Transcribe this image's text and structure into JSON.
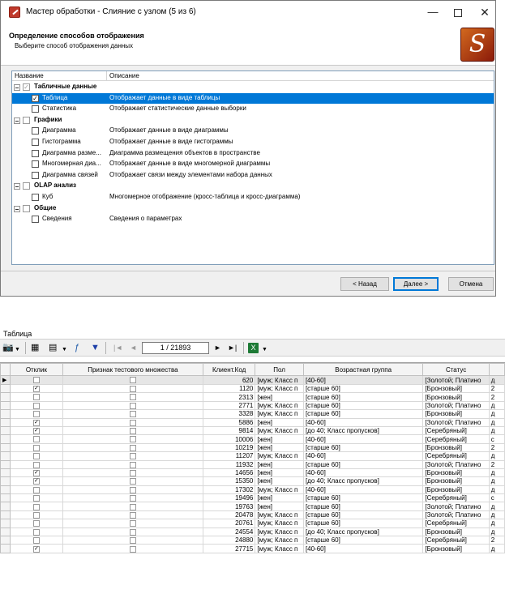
{
  "dialog": {
    "title": "Мастер обработки - Слияние с узлом (5 из 6)",
    "header_title": "Определение способов отображения",
    "header_subtitle": "Выберите способ отображения данных",
    "logo_glyph": "𝑆",
    "minimize_glyph": "—",
    "close_glyph": "✕",
    "columns": [
      "Название",
      "Описание"
    ],
    "groups": [
      {
        "name": "Табличные данные",
        "checked": true,
        "items": [
          {
            "name": "Таблица",
            "desc": "Отображает данные в виде таблицы",
            "checked": true,
            "selected": true
          },
          {
            "name": "Статистика",
            "desc": "Отображает статистические данные выборки",
            "checked": false
          }
        ]
      },
      {
        "name": "Графики",
        "checked": false,
        "items": [
          {
            "name": "Диаграмма",
            "desc": "Отображает данные в виде диаграммы",
            "checked": false
          },
          {
            "name": "Гистограмма",
            "desc": "Отображает данные в виде гистограммы",
            "checked": false
          },
          {
            "name": "Диаграмма разме...",
            "desc": "Диаграмма размещения объектов в пространстве",
            "checked": false
          },
          {
            "name": "Многомерная диа...",
            "desc": "Отображает данные в виде многомерной диаграммы",
            "checked": false
          },
          {
            "name": "Диаграмма связей",
            "desc": "Отображает связи между элементами набора данных",
            "checked": false
          }
        ]
      },
      {
        "name": "OLAP анализ",
        "checked": false,
        "items": [
          {
            "name": "Куб",
            "desc": "Многомерное отображение (кросс-таблица и кросс-диаграмма)",
            "checked": false
          }
        ]
      },
      {
        "name": "Общие",
        "checked": false,
        "items": [
          {
            "name": "Сведения",
            "desc": "Сведения о параметрах",
            "checked": false
          }
        ]
      }
    ],
    "buttons": {
      "back": "< Назад",
      "next": "Далее >",
      "cancel": "Отмена"
    }
  },
  "table_panel": {
    "title": "Таблица",
    "pager": "1 / 21893",
    "toolbar_icons": [
      "camera-icon",
      "properties-icon",
      "columns-icon",
      "formula-icon",
      "filter-icon",
      "first-page-icon",
      "prev-page-icon",
      "next-page-icon",
      "last-page-icon",
      "excel-export-icon"
    ],
    "columns": [
      "Отклик",
      "Признак тестового множества",
      "Клиент.Код",
      "Пол",
      "Возрастная группа",
      "Статус"
    ],
    "rows": [
      {
        "otklik": false,
        "test": false,
        "kod": "620",
        "pol": "[муж; Класс п",
        "vozrast": "[40-60]",
        "status": "[Золотой; Платино",
        "extra": "д"
      },
      {
        "otklik": true,
        "test": false,
        "kod": "1120",
        "pol": "[муж; Класс п",
        "vozrast": "[старше 60]",
        "status": "[Бронзовый]",
        "extra": "2"
      },
      {
        "otklik": false,
        "test": false,
        "kod": "2313",
        "pol": "[жен]",
        "vozrast": "[старше 60]",
        "status": "[Бронзовый]",
        "extra": "2"
      },
      {
        "otklik": false,
        "test": false,
        "kod": "2771",
        "pol": "[муж; Класс п",
        "vozrast": "[старше 60]",
        "status": "[Золотой; Платино",
        "extra": "д"
      },
      {
        "otklik": false,
        "test": false,
        "kod": "3328",
        "pol": "[муж; Класс п",
        "vozrast": "[старше 60]",
        "status": "[Бронзовый]",
        "extra": "д"
      },
      {
        "otklik": true,
        "test": false,
        "kod": "5886",
        "pol": "[жен]",
        "vozrast": "[40-60]",
        "status": "[Золотой; Платино",
        "extra": "д"
      },
      {
        "otklik": true,
        "test": false,
        "kod": "9814",
        "pol": "[муж; Класс п",
        "vozrast": "[до 40; Класс пропусков]",
        "status": "[Серебряный]",
        "extra": "д"
      },
      {
        "otklik": false,
        "test": false,
        "kod": "10006",
        "pol": "[жен]",
        "vozrast": "[40-60]",
        "status": "[Серебряный]",
        "extra": "с"
      },
      {
        "otklik": false,
        "test": false,
        "kod": "10219",
        "pol": "[жен]",
        "vozrast": "[старше 60]",
        "status": "[Бронзовый]",
        "extra": "2"
      },
      {
        "otklik": false,
        "test": false,
        "kod": "11207",
        "pol": "[муж; Класс п",
        "vozrast": "[40-60]",
        "status": "[Серебряный]",
        "extra": "д"
      },
      {
        "otklik": false,
        "test": false,
        "kod": "11932",
        "pol": "[жен]",
        "vozrast": "[старше 60]",
        "status": "[Золотой; Платино",
        "extra": "2"
      },
      {
        "otklik": true,
        "test": false,
        "kod": "14656",
        "pol": "[жен]",
        "vozrast": "[40-60]",
        "status": "[Бронзовый]",
        "extra": "д"
      },
      {
        "otklik": true,
        "test": false,
        "kod": "15350",
        "pol": "[жен]",
        "vozrast": "[до 40; Класс пропусков]",
        "status": "[Бронзовый]",
        "extra": "д"
      },
      {
        "otklik": false,
        "test": false,
        "kod": "17302",
        "pol": "[муж; Класс п",
        "vozrast": "[40-60]",
        "status": "[Бронзовый]",
        "extra": "д"
      },
      {
        "otklik": false,
        "test": false,
        "kod": "19496",
        "pol": "[жен]",
        "vozrast": "[старше 60]",
        "status": "[Серебряный]",
        "extra": "с"
      },
      {
        "otklik": false,
        "test": false,
        "kod": "19763",
        "pol": "[жен]",
        "vozrast": "[старше 60]",
        "status": "[Золотой; Платино",
        "extra": "д"
      },
      {
        "otklik": false,
        "test": false,
        "kod": "20478",
        "pol": "[муж; Класс п",
        "vozrast": "[старше 60]",
        "status": "[Золотой; Платино",
        "extra": "д"
      },
      {
        "otklik": false,
        "test": false,
        "kod": "20761",
        "pol": "[муж; Класс п",
        "vozrast": "[старше 60]",
        "status": "[Серебряный]",
        "extra": "д"
      },
      {
        "otklik": false,
        "test": false,
        "kod": "24554",
        "pol": "[муж; Класс п",
        "vozrast": "[до 40; Класс пропусков]",
        "status": "[Бронзовый]",
        "extra": "д"
      },
      {
        "otklik": false,
        "test": false,
        "kod": "24880",
        "pol": "[муж; Класс п",
        "vozrast": "[старше 60]",
        "status": "[Серебряный]",
        "extra": "2"
      },
      {
        "otklik": true,
        "test": false,
        "kod": "27715",
        "pol": "[муж; Класс п",
        "vozrast": "[40-60]",
        "status": "[Бронзовый]",
        "extra": "д"
      }
    ]
  }
}
